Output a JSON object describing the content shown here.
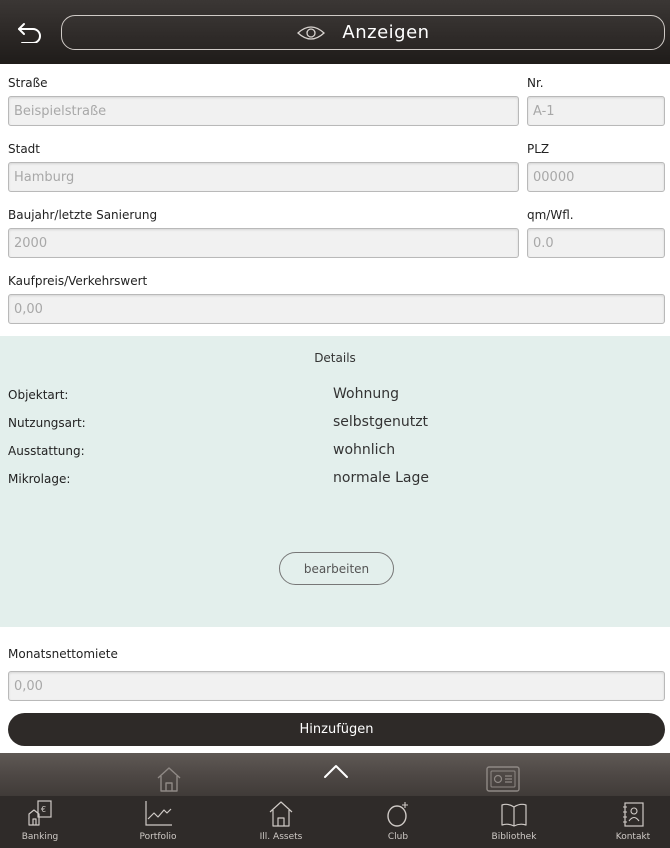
{
  "header": {
    "title": "Anzeigen",
    "back_icon": "back-arrow-icon",
    "title_icon": "eye-icon"
  },
  "form": {
    "strasse": {
      "label": "Straße",
      "placeholder": "Beispielstraße"
    },
    "nr": {
      "label": "Nr.",
      "placeholder": "A-1"
    },
    "stadt": {
      "label": "Stadt",
      "placeholder": "Hamburg"
    },
    "plz": {
      "label": "PLZ",
      "placeholder": "00000"
    },
    "baujahr": {
      "label": "Baujahr/letzte Sanierung",
      "placeholder": "2000"
    },
    "qm": {
      "label": "qm/Wfl.",
      "placeholder": "0.0"
    },
    "kaufpreis": {
      "label": "Kaufpreis/Verkehrswert",
      "placeholder": "0,00"
    }
  },
  "details": {
    "title": "Details",
    "rows": [
      {
        "key": "Objektart:",
        "value": "Wohnung"
      },
      {
        "key": "Nutzungsart:",
        "value": "selbstgenutzt"
      },
      {
        "key": "Ausstattung:",
        "value": "wohnlich"
      },
      {
        "key": "Mikrolage:",
        "value": "normale Lage"
      }
    ],
    "edit_label": "bearbeiten"
  },
  "miete": {
    "label": "Monatsnettomiete",
    "placeholder": "0,00"
  },
  "add_label": "Hinzufügen",
  "subbar": {
    "icons": [
      "house-icon",
      "chevron-up-icon",
      "safe-icon"
    ]
  },
  "tabs": [
    {
      "label": "Banking",
      "icon": "banking-icon"
    },
    {
      "label": "Portfolio",
      "icon": "chart-line-icon"
    },
    {
      "label": "Ill. Assets",
      "icon": "house-icon"
    },
    {
      "label": "Club",
      "icon": "ring-icon"
    },
    {
      "label": "Bibliothek",
      "icon": "book-icon"
    },
    {
      "label": "Kontakt",
      "icon": "contact-book-icon"
    }
  ],
  "colors": {
    "header_bg": "#2a2624",
    "details_bg": "#e3efec",
    "button_dark": "#2e2a28",
    "tabbar_bg": "#2f2b29"
  }
}
